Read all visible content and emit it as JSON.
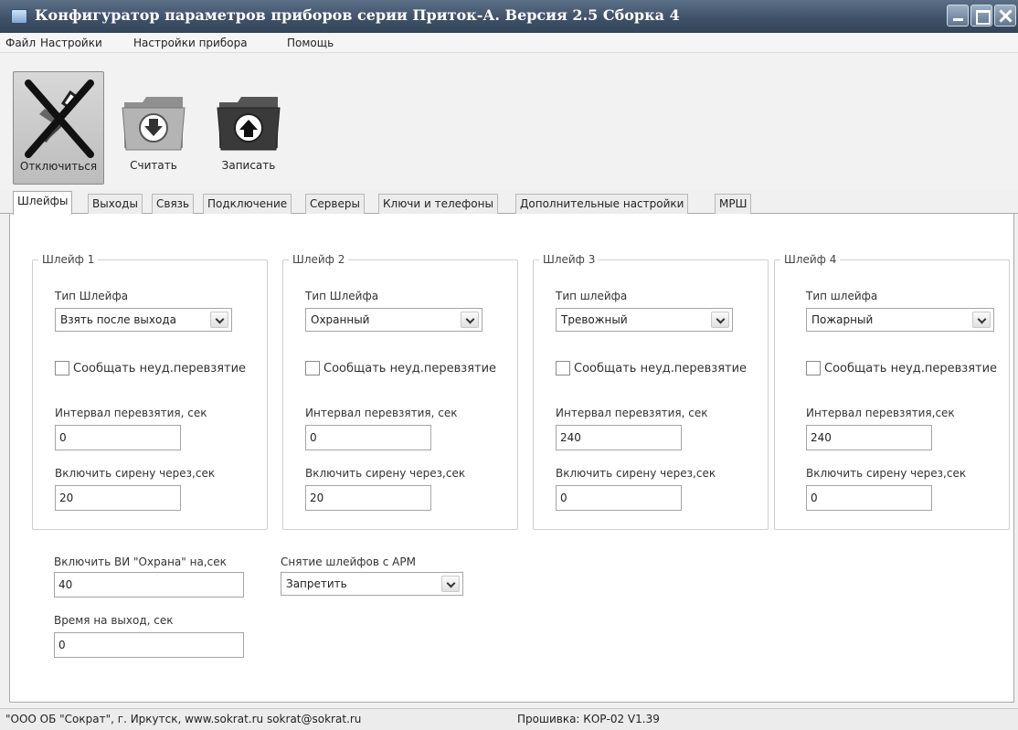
{
  "window": {
    "title": "Конфигуратор параметров приборов серии Приток-А. Версия 2.5 Сборка 4"
  },
  "menu": [
    "Файл",
    "Настройки",
    "Настройки прибора",
    "Помощь"
  ],
  "toolbar": {
    "disconnect_label": "Отключиться",
    "read_label": "Считать",
    "write_label": "Записать"
  },
  "tabs": [
    "Шлейфы",
    "Выходы",
    "Связь",
    "Подключение",
    "Серверы",
    "Ключи и телефоны",
    "Дополнительные настройки",
    "МРШ"
  ],
  "loops": [
    {
      "title": "Шлейф 1",
      "type_label": "Тип Шлейфа",
      "type_value": "Взять после выхода",
      "report_label": "Сообщать неуд.перевзятие",
      "rearm_label": "Интервал перевзятия, сек",
      "rearm_value": "0",
      "siren_label": "Включить сирену через,сек",
      "siren_value": "20"
    },
    {
      "title": "Шлейф 2",
      "type_label": "Тип Шлейфа",
      "type_value": "Охранный",
      "report_label": "Сообщать неуд.перевзятие",
      "rearm_label": "Интервал перевзятия, сек",
      "rearm_value": "0",
      "siren_label": "Включить сирену через,сек",
      "siren_value": "20"
    },
    {
      "title": "Шлейф 3",
      "type_label": "Тип шлейфа",
      "type_value": "Тревожный",
      "report_label": "Сообщать неуд.перевзятие",
      "rearm_label": "Интервал перевзятия, сек",
      "rearm_value": "240",
      "siren_label": "Включить сирену через,сек",
      "siren_value": "0"
    },
    {
      "title": "Шлейф 4",
      "type_label": "Тип шлейфа",
      "type_value": "Пожарный",
      "report_label": "Сообщать неуд.перевзятие",
      "rearm_label": "Интервал перевзятия,сек",
      "rearm_value": "240",
      "siren_label": "Включить сирену через,сек",
      "siren_value": "0"
    }
  ],
  "general": {
    "vi_label": "Включить ВИ \"Охрана\" на,сек",
    "vi_value": "40",
    "exit_time_label": "Время на выход, сек",
    "exit_time_value": "0",
    "disarm_label": "Снятие шлейфов с АРМ",
    "disarm_value": "Запретить"
  },
  "status": {
    "company": "\"ООО ОБ \"Сократ\", г. Иркутск,    www.sokrat.ru   sokrat@sokrat.ru",
    "firmware": "Прошивка: КОР-02 V1.39"
  }
}
